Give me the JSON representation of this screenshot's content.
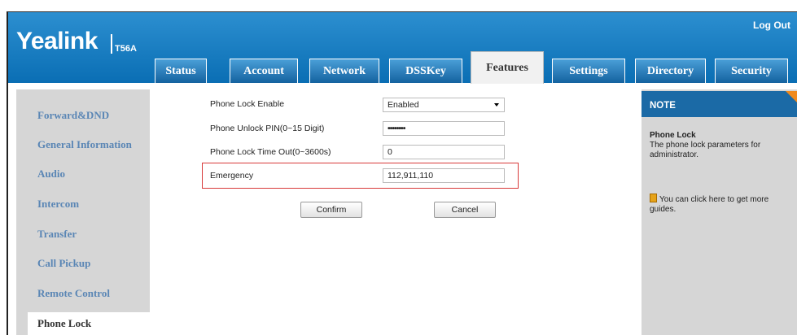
{
  "brand": {
    "logo": "Yealink",
    "model": "T56A"
  },
  "header": {
    "logout": "Log Out"
  },
  "tabs": [
    {
      "label": "Status"
    },
    {
      "label": "Account"
    },
    {
      "label": "Network"
    },
    {
      "label": "DSSKey"
    },
    {
      "label": "Features",
      "active": true
    },
    {
      "label": "Settings"
    },
    {
      "label": "Directory"
    },
    {
      "label": "Security"
    }
  ],
  "sidebar": {
    "items": [
      {
        "label": "Forward&DND"
      },
      {
        "label": "General Information"
      },
      {
        "label": "Audio"
      },
      {
        "label": "Intercom"
      },
      {
        "label": "Transfer"
      },
      {
        "label": "Call Pickup"
      },
      {
        "label": "Remote Control"
      },
      {
        "label": "Phone Lock",
        "active": true
      }
    ]
  },
  "form": {
    "phone_lock_enable": {
      "label": "Phone Lock Enable",
      "value": "Enabled"
    },
    "unlock_pin": {
      "label": "Phone Unlock PIN(0~15 Digit)",
      "value": "••••••••"
    },
    "lock_timeout": {
      "label": "Phone Lock Time Out(0~3600s)",
      "value": "0"
    },
    "emergency": {
      "label": "Emergency",
      "value": "112,911,110"
    },
    "confirm_label": "Confirm",
    "cancel_label": "Cancel"
  },
  "note": {
    "title": "NOTE",
    "heading": "Phone Lock",
    "body": "The phone lock parameters for administrator.",
    "guide": "You can click here to get more guides."
  },
  "colors": {
    "header_blue": "#0e7ac0",
    "link_blue": "#5a86b5",
    "highlight_red": "#d83a3a",
    "note_corner": "#f08a1d"
  }
}
